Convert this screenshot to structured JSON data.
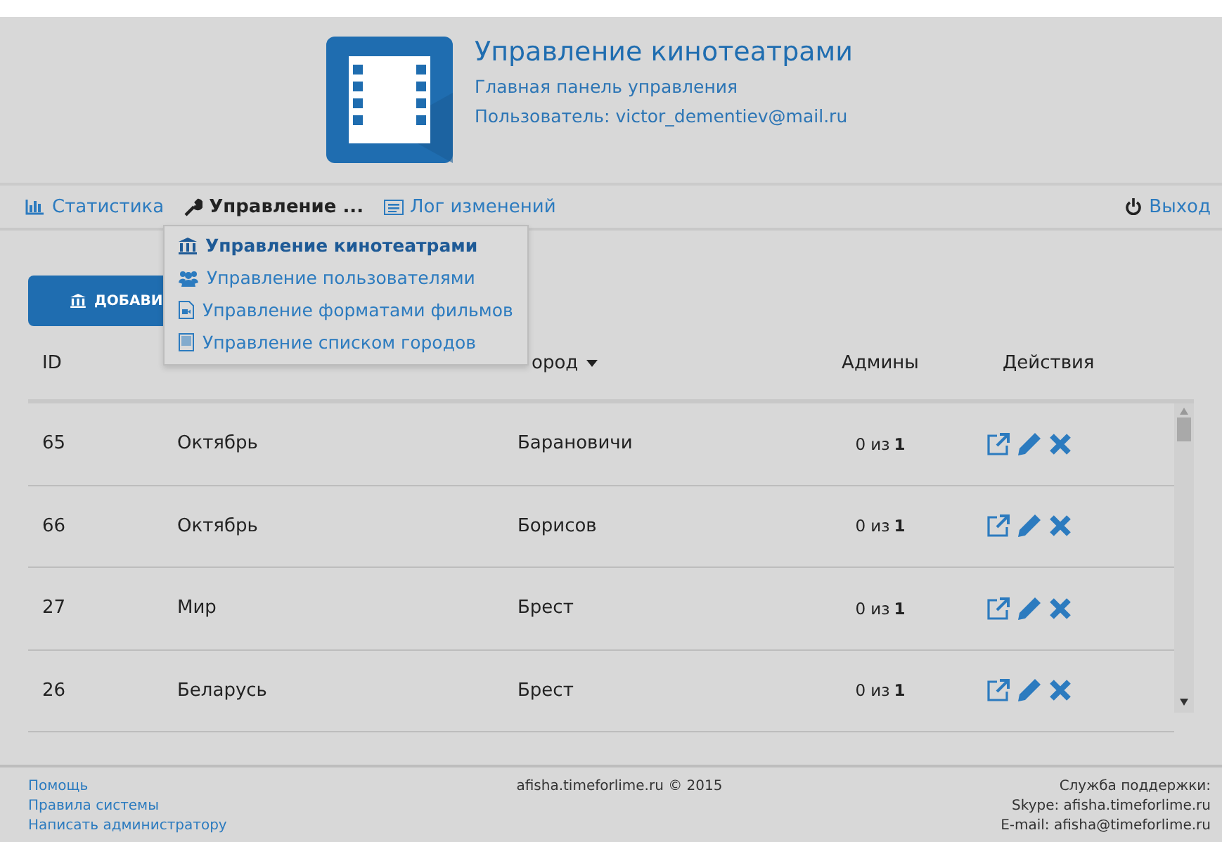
{
  "header": {
    "title": "Управление кинотеатрами",
    "subtitle": "Главная панель управления",
    "user": "Пользователь: victor_dementiev@mail.ru"
  },
  "nav": {
    "items": [
      {
        "kind": "stats",
        "label": "Статистика",
        "selected": false
      },
      {
        "kind": "tools",
        "label": "Управление ...",
        "selected": true
      },
      {
        "kind": "log",
        "label": "Лог изменений",
        "selected": false
      }
    ],
    "logout": "Выход"
  },
  "dropdown": [
    {
      "kind": "cinema",
      "label": "Управление кинотеатрами",
      "selected": true
    },
    {
      "kind": "users",
      "label": "Управление пользователями",
      "selected": false
    },
    {
      "kind": "formats",
      "label": "Управление форматами фильмов",
      "selected": false
    },
    {
      "kind": "cities",
      "label": "Управление списком городов",
      "selected": false
    }
  ],
  "add_button": "ДОБАВИ",
  "table": {
    "columns": [
      "ID",
      "ород",
      "Админы",
      "Действия"
    ],
    "rows": [
      {
        "id": "65",
        "name": "Октябрь",
        "city": "Барановичи",
        "admins_prefix": "0 из",
        "admins_total": "1"
      },
      {
        "id": "66",
        "name": "Октябрь",
        "city": "Борисов",
        "admins_prefix": "0 из",
        "admins_total": "1"
      },
      {
        "id": "27",
        "name": "Мир",
        "city": "Брест",
        "admins_prefix": "0 из",
        "admins_total": "1"
      },
      {
        "id": "26",
        "name": "Беларусь",
        "city": "Брест",
        "admins_prefix": "0 из",
        "admins_total": "1"
      }
    ]
  },
  "footer": {
    "links": [
      "Помощь",
      "Правила системы",
      "Написать администратору"
    ],
    "copyright": "afisha.timeforlime.ru © 2015",
    "support": [
      "Служба поддержки:",
      "Skype: afisha.timeforlime.ru",
      "E-mail: afisha@timeforlime.ru"
    ]
  }
}
